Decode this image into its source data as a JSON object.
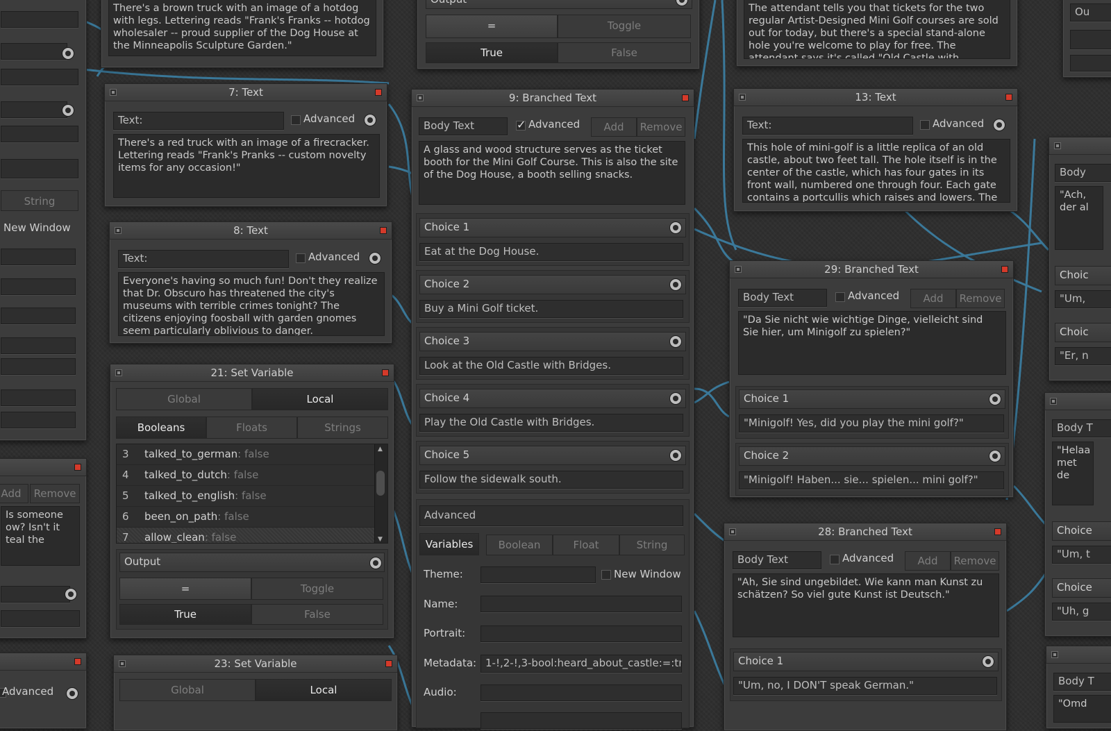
{
  "left_panel": {
    "string_btn": "String",
    "new_window_label": "New Window",
    "add_btn": "Add",
    "remove_btn": "Remove",
    "text_lines": [
      "Is someone",
      "ow? Isn't it",
      "teal the"
    ],
    "advanced_label": "Advanced"
  },
  "top_left_text": "There's a brown truck with an image of a hotdog with legs. Lettering reads \"Frank's Franks -- hotdog wholesaler -- proud supplier of the Dog House at the Minneapolis Sculpture Garden.\"",
  "top_center": {
    "output_label": "Output",
    "eq_btn": "=",
    "toggle_btn": "Toggle",
    "true_btn": "True",
    "false_btn": "False"
  },
  "top_right_text": "The attendant tells you that tickets for the two regular Artist-Designed Mini Golf courses are sold out for today, but there's a special stand-alone hole you're welcome to play for free. The attendant says it's called \"Old Castle with Bridges,\" and it's an",
  "node7": {
    "title": "7: Text",
    "text_label": "Text:",
    "advanced_label": "Advanced",
    "body": "There's a red truck with an image of a firecracker. Lettering reads \"Frank's Pranks -- custom novelty items for any occasion!\""
  },
  "node8": {
    "title": "8: Text",
    "text_label": "Text:",
    "advanced_label": "Advanced",
    "body": "Everyone's having so much fun! Don't they realize that Dr. Obscuro has threatened the city's museums with terrible crimes tonight? The citizens enjoying foosball with garden gnomes seem particularly oblivious to danger."
  },
  "node21": {
    "title": "21: Set Variable",
    "scope_tabs": [
      "Global",
      "Local"
    ],
    "type_tabs": [
      "Booleans",
      "Floats",
      "Strings"
    ],
    "variables": [
      {
        "n": "3",
        "name": "talked_to_german",
        "val": ": false"
      },
      {
        "n": "4",
        "name": "talked_to_dutch",
        "val": ": false"
      },
      {
        "n": "5",
        "name": "talked_to_english",
        "val": ": false"
      },
      {
        "n": "6",
        "name": "been_on_path",
        "val": ": false"
      },
      {
        "n": "7",
        "name": "allow_clean",
        "val": ": false"
      }
    ],
    "output_label": "Output",
    "eq_btn": "=",
    "toggle_btn": "Toggle",
    "true_btn": "True",
    "false_btn": "False"
  },
  "node23": {
    "title": "23: Set Variable",
    "scope_tabs": [
      "Global",
      "Local"
    ]
  },
  "node9": {
    "title": "9: Branched Text",
    "body_text_label": "Body Text",
    "advanced_label": "Advanced",
    "add_btn": "Add",
    "remove_btn": "Remove",
    "body": "A glass and wood structure serves as the ticket booth for the Mini Golf Course. This is also the site of the Dog House, a booth selling snacks.",
    "choices": [
      {
        "label": "Choice 1",
        "text": "Eat at the Dog House."
      },
      {
        "label": "Choice 2",
        "text": "Buy a Mini Golf ticket."
      },
      {
        "label": "Choice 3",
        "text": "Look at the Old Castle with Bridges."
      },
      {
        "label": "Choice 4",
        "text": "Play the Old Castle with Bridges."
      },
      {
        "label": "Choice 5",
        "text": "Follow the sidewalk south."
      }
    ],
    "advanced_section": "Advanced",
    "variables_btn": "Variables",
    "var_tabs": [
      "Boolean",
      "Float",
      "String"
    ],
    "theme_label": "Theme:",
    "new_window_label": "New Window",
    "name_label": "Name:",
    "portrait_label": "Portrait:",
    "metadata_label": "Metadata:",
    "metadata_value": "1-!,2-!,3-bool:heard_about_castle:=:tr",
    "audio_label": "Audio:"
  },
  "node13": {
    "title": "13: Text",
    "text_label": "Text:",
    "advanced_label": "Advanced",
    "body": "This hole of mini-golf is a little replica of an old castle, about two feet tall. The hole itself is in the center of the castle, which has four gates in its front wall, numbered one through four. Each gate contains a portcullis which raises and lowers. The"
  },
  "node29": {
    "title": "29: Branched Text",
    "body_text_label": "Body Text",
    "advanced_label": "Advanced",
    "add_btn": "Add",
    "remove_btn": "Remove",
    "body": "\"Da Sie nicht wie wichtige Dinge, vielleicht sind Sie hier, um Minigolf zu spielen?\"",
    "choices": [
      {
        "label": "Choice 1",
        "text": "\"Minigolf! Yes, did you play the mini golf?\""
      },
      {
        "label": "Choice 2",
        "text": "\"Minigolf! Haben... sie... spielen... mini golf?\""
      }
    ]
  },
  "node28": {
    "title": "28: Branched Text",
    "body_text_label": "Body Text",
    "advanced_label": "Advanced",
    "add_btn": "Add",
    "remove_btn": "Remove",
    "body": "\"Ah, Sie sind ungebildet. Wie kann man Kunst zu schätzen? So viel gute Kunst ist Deutsch.\"",
    "choices": [
      {
        "label": "Choice 1",
        "text": "\"Um, no, I DON'T speak German.\""
      }
    ]
  },
  "right_edge": {
    "ou": "Ou",
    "body1": "Body",
    "body1_text": "\"Ach, der al",
    "choice_a": "Choic",
    "choice_a_text": "\"Um,",
    "choice_b": "Choic",
    "choice_b_text": "\"Er, n",
    "body2": "Body T",
    "body2_text": "\"Helaa met de",
    "choice_c": "Choice",
    "choice_c_text": "\"Um, t",
    "choice_d": "Choice",
    "choice_d_text": "\"Uh, g",
    "body3": "Body T",
    "body3_text": "\"Omd"
  },
  "colors": {
    "wire": "#3f8ab0",
    "close": "#d43a2a",
    "background": "#2f2f2f"
  }
}
